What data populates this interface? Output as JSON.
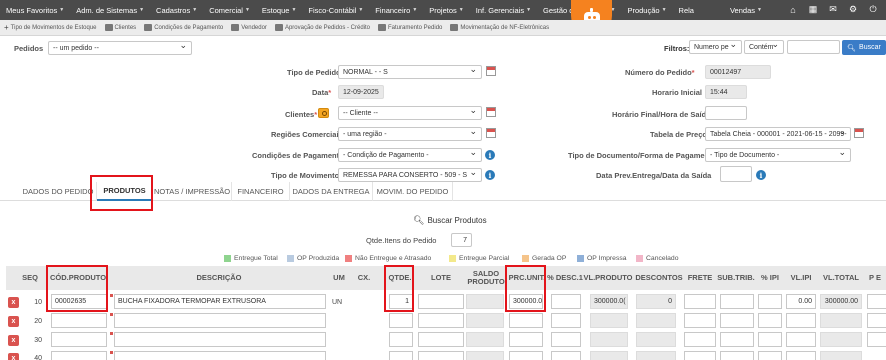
{
  "menu": [
    "Meus Favoritos",
    "Adm. de Sistemas",
    "Cadastros",
    "Comercial",
    "Estoque",
    "Fisco-Contábil",
    "Financeiro",
    "Projetos",
    "Inf. Gerenciais",
    "Gestão de Pessoas",
    "Produção",
    "Rela",
    "Vendas"
  ],
  "shortcuts": [
    "Tipo de Movimentos de Estoque",
    "Clientes",
    "Condições de Pagamento",
    "Vendedor",
    "Aprovação de Pedidos - Crédito",
    "Faturamento Pedido",
    "Movimentação de NF-Eletrônicas"
  ],
  "pedidos": {
    "label": "Pedidos",
    "value": "-- um pedido --"
  },
  "filtros": {
    "label": "Filtros:",
    "field": "Numero pe",
    "mode": "Contém",
    "search_value": "",
    "button": "Buscar"
  },
  "form": {
    "tipo_pedido": {
      "label": "Tipo de Pedido",
      "value": "NORMAL - - S"
    },
    "data": {
      "label": "Data",
      "value": "12-09-2025"
    },
    "clientes": {
      "label": "Clientes",
      "value": "-- Cliente --"
    },
    "regioes": {
      "label": "Regiões Comerciais",
      "value": "- uma região -"
    },
    "condicoes": {
      "label": "Condições de Pagamento",
      "value": "- Condição de Pagamento -"
    },
    "tipo_movimento": {
      "label": "Tipo de Movimento",
      "value": "REMESSA PARA CONSERTO - 509 - S"
    },
    "numero_pedido": {
      "label": "Número do Pedido",
      "value": "00012497"
    },
    "horario_inicial": {
      "label": "Horario Inicial",
      "value": "15:44"
    },
    "horario_final": {
      "label": "Horário Final/Hora de Saída",
      "value": ""
    },
    "tabela_preco": {
      "label": "Tabela de Preço",
      "value": "Tabela Cheia - 000001 - 2021-06-15 - 2099-"
    },
    "tipo_documento": {
      "label": "Tipo de Documento/Forma de Pagamento",
      "value": "- Tipo de Documento -"
    },
    "data_prev": {
      "label": "Data Prev.Entrega/Data da Saída",
      "value": ""
    }
  },
  "tabs": [
    "DADOS DO PEDIDO",
    "PRODUTOS",
    "NOTAS / IMPRESSÃO",
    "FINANCEIRO",
    "DADOS DA ENTREGA",
    "MOVIM. DO PEDIDO"
  ],
  "buscar_produtos": "Buscar Produtos",
  "qtde_itens": {
    "label": "Qtde.Itens do Pedido",
    "value": "7"
  },
  "legend": [
    {
      "label": "Entregue Total",
      "color": "#8fd48f"
    },
    {
      "label": "OP Produzida",
      "color": "#b9cbe0"
    },
    {
      "label": "Não Entregue e Atrasado",
      "color": "#f08080"
    },
    {
      "label": "Entregue Parcial",
      "color": "#f3e98b"
    },
    {
      "label": "Gerada OP",
      "color": "#f5c48a"
    },
    {
      "label": "OP Impressa",
      "color": "#8fb0d8"
    },
    {
      "label": "Cancelado",
      "color": "#f2b6c8"
    }
  ],
  "table": {
    "headers": [
      "SEQ",
      "CÓD.PRODUTO",
      "DESCRIÇÃO",
      "UM",
      "CX.",
      "QTDE.",
      "LOTE",
      "SALDO PRODUTO",
      "PRC.UNIT.",
      "% DESC.1",
      "VL.PRODUTO",
      "DESCONTOS",
      "FRETE",
      "SUB.TRIB.",
      "% IPI",
      "VL.IPI",
      "VL.TOTAL",
      "P E"
    ],
    "rows": [
      {
        "seq": "10",
        "codigo": "00002635",
        "descricao": "BUCHA FIXADORA TERMOPAR EXTRUSORA",
        "um": "UN",
        "cx": "",
        "qtde": "1",
        "lote": "",
        "saldo": "",
        "prc_unit": "300000.0(",
        "desc1": "",
        "vl_produto": "300000.0(",
        "descontos": "0",
        "frete": "",
        "sub_trib": "",
        "ipi": "",
        "vl_ipi": "0.00",
        "vl_total": "300000.00"
      },
      {
        "seq": "20"
      },
      {
        "seq": "30"
      },
      {
        "seq": "40"
      }
    ]
  }
}
